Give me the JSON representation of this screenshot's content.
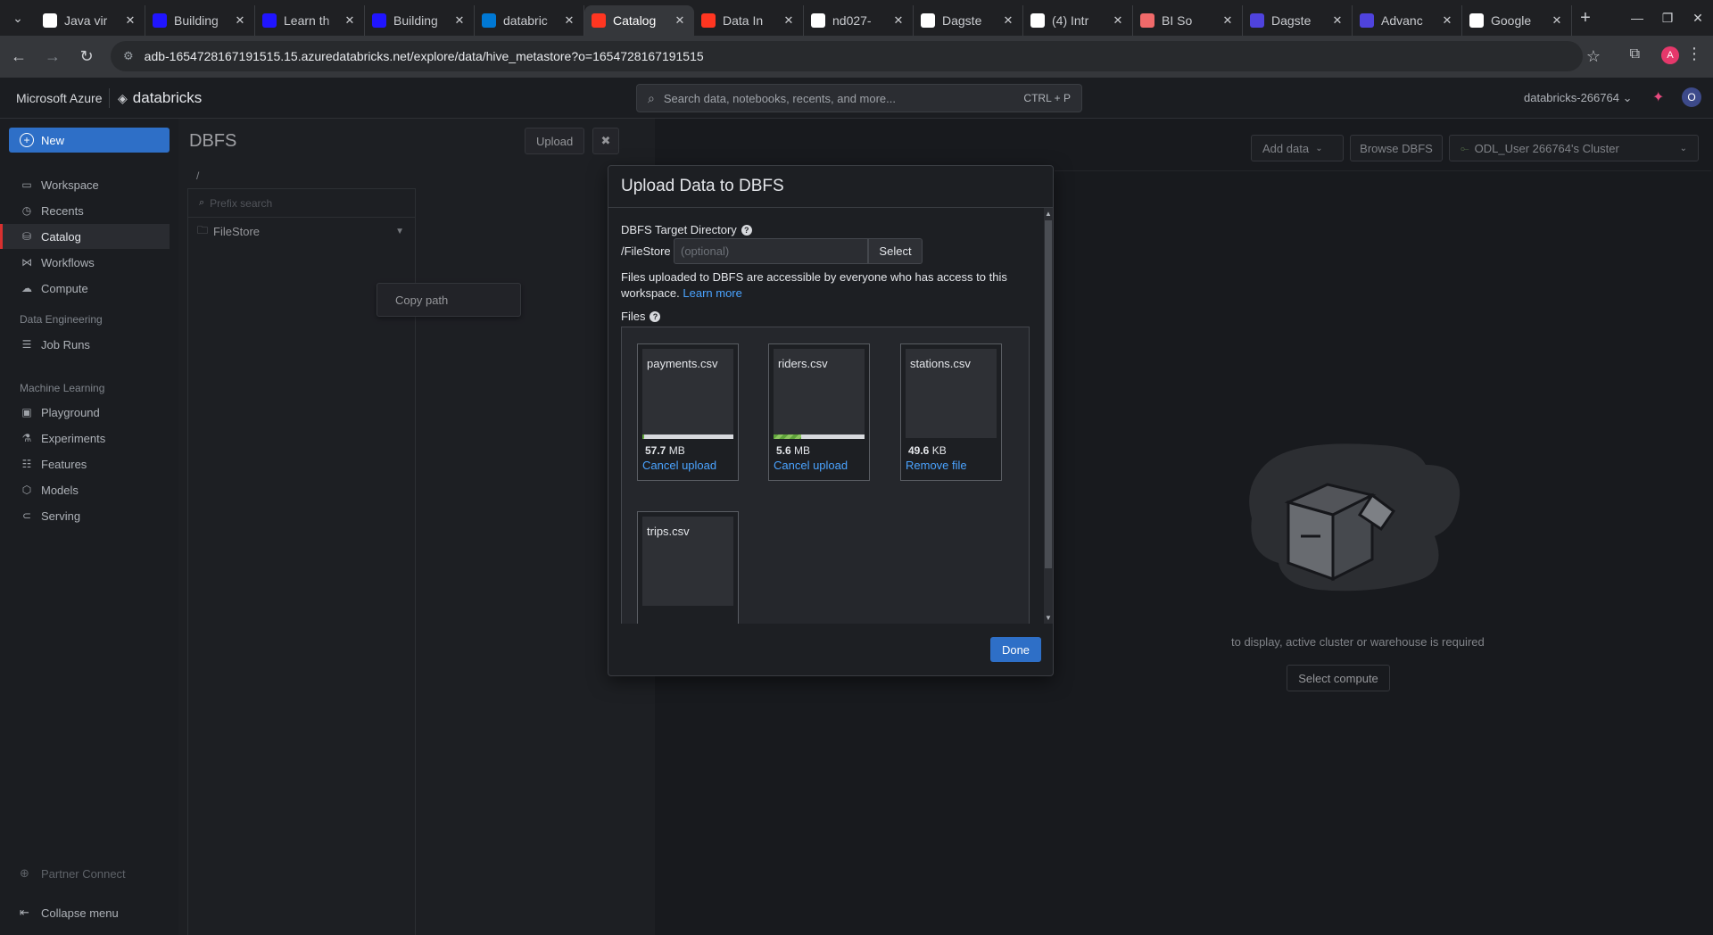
{
  "browser": {
    "tabs": [
      {
        "title": "Java vir",
        "icon": "wikipedia-icon",
        "color": "#ffffff"
      },
      {
        "title": "Building",
        "icon": "udacity-icon",
        "color": "#2015ff"
      },
      {
        "title": "Learn th",
        "icon": "udacity-icon",
        "color": "#2015ff"
      },
      {
        "title": "Building",
        "icon": "udacity-icon",
        "color": "#2015ff"
      },
      {
        "title": "databric",
        "icon": "azure-icon",
        "color": "#0078d4"
      },
      {
        "title": "Catalog",
        "icon": "databricks-icon",
        "color": "#ff3621"
      },
      {
        "title": "Data In",
        "icon": "databricks-icon",
        "color": "#ff3621"
      },
      {
        "title": "nd027-",
        "icon": "github-icon",
        "color": "#ffffff"
      },
      {
        "title": "Dagste",
        "icon": "chatgpt-icon",
        "color": "#ffffff"
      },
      {
        "title": "(4) Intr",
        "icon": "notion-icon",
        "color": "#ffffff"
      },
      {
        "title": "BI So",
        "icon": "asana-icon",
        "color": "#f06a6a"
      },
      {
        "title": "Dagste",
        "icon": "dagster-icon",
        "color": "#4f43dd"
      },
      {
        "title": "Advanc",
        "icon": "dagster-icon",
        "color": "#4f43dd"
      },
      {
        "title": "Google",
        "icon": "google-icon",
        "color": "#ffffff"
      }
    ],
    "url": "adb-1654728167191515.15.azuredatabricks.net/explore/data/hive_metastore?o=1654728167191515",
    "profile_initial": "A"
  },
  "header": {
    "brand_azure": "Microsoft Azure",
    "brand_databricks": "databricks",
    "search_placeholder": "Search data, notebooks, recents, and more...",
    "search_shortcut": "CTRL + P",
    "workspace": "databricks-266764",
    "user_initial": "O"
  },
  "sidebar": {
    "new_label": "New",
    "items_top": [
      {
        "label": "Workspace",
        "icon": "folder-icon"
      },
      {
        "label": "Recents",
        "icon": "clock-icon"
      },
      {
        "label": "Catalog",
        "icon": "catalog-icon",
        "selected": true
      },
      {
        "label": "Workflows",
        "icon": "workflows-icon"
      },
      {
        "label": "Compute",
        "icon": "cloud-icon"
      }
    ],
    "section_data_engineering": "Data Engineering",
    "job_runs": "Job Runs",
    "section_machine_learning": "Machine Learning",
    "items_ml": [
      {
        "label": "Playground",
        "icon": "playground-icon"
      },
      {
        "label": "Experiments",
        "icon": "experiments-icon"
      },
      {
        "label": "Features",
        "icon": "features-icon"
      },
      {
        "label": "Models",
        "icon": "models-icon"
      },
      {
        "label": "Serving",
        "icon": "serving-icon"
      }
    ],
    "partner_connect": "Partner Connect",
    "collapse_menu": "Collapse menu"
  },
  "dbfs": {
    "title": "DBFS",
    "upload_label": "Upload",
    "path": "/",
    "prefix_search_placeholder": "Prefix search",
    "tree_item": "FileStore",
    "context_menu_item": "Copy path"
  },
  "right_pane": {
    "add_data_label": "Add data",
    "browse_dbfs_label": "Browse DBFS",
    "cluster": "ODL_User 266764's Cluster",
    "empty_message": "to display, active cluster or warehouse is required",
    "select_compute_label": "Select compute"
  },
  "modal": {
    "title": "Upload Data to DBFS",
    "target_dir_label": "DBFS Target Directory",
    "target_prefix": "/FileStore",
    "target_placeholder": "(optional)",
    "select_label": "Select",
    "access_note": "Files uploaded to DBFS are accessible by everyone who has access to this workspace.",
    "learn_more": "Learn more",
    "files_label": "Files",
    "files": [
      {
        "name": "payments.csv",
        "size_value": "57.7",
        "size_unit": "MB",
        "action": "Cancel upload",
        "progress": 0.02
      },
      {
        "name": "riders.csv",
        "size_value": "5.6",
        "size_unit": "MB",
        "action": "Cancel upload",
        "progress": 0.3
      },
      {
        "name": "stations.csv",
        "size_value": "49.6",
        "size_unit": "KB",
        "action": "Remove file",
        "progress": null
      },
      {
        "name": "trips.csv",
        "size_value": "",
        "size_unit": "",
        "action": "",
        "progress": null
      }
    ],
    "done_label": "Done"
  }
}
